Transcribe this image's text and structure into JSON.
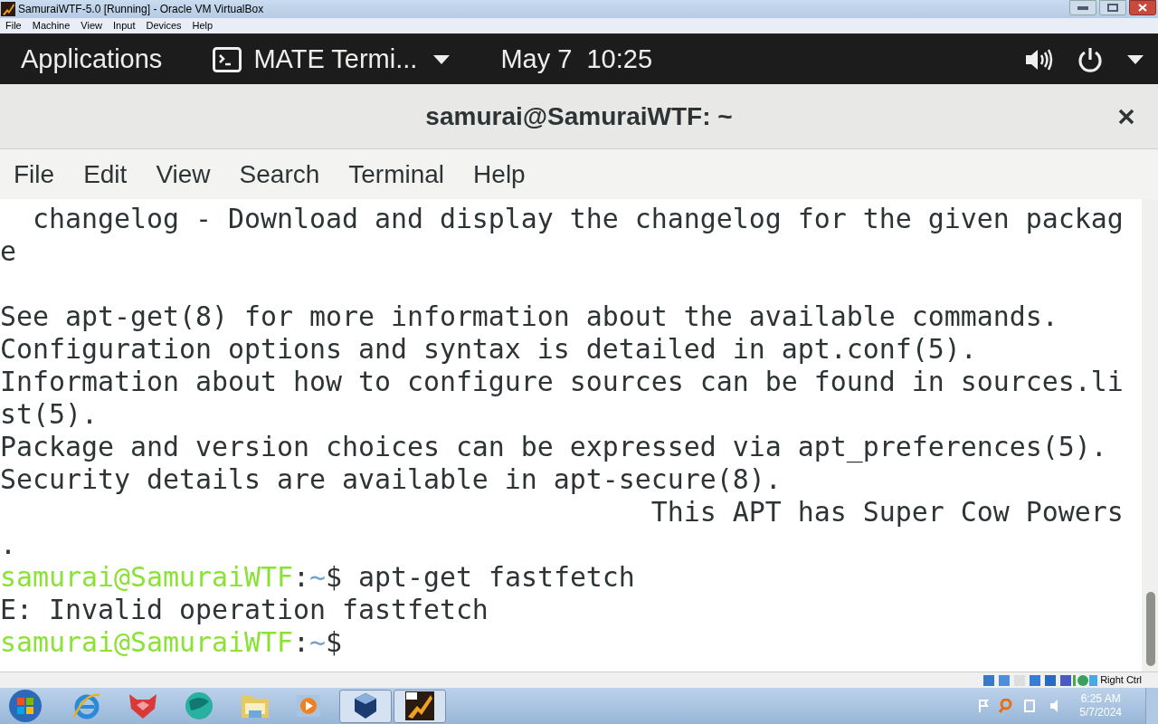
{
  "host_window": {
    "title": "SamuraiWTF-5.0 [Running] - Oracle VM VirtualBox",
    "menu": [
      "File",
      "Machine",
      "View",
      "Input",
      "Devices",
      "Help"
    ]
  },
  "top_panel": {
    "applications": "Applications",
    "task": "MATE Termi...",
    "clock": "May 7  10:25"
  },
  "terminal": {
    "title": "samurai@SamuraiWTF: ~",
    "menu": [
      "File",
      "Edit",
      "View",
      "Search",
      "Terminal",
      "Help"
    ],
    "lines": [
      {
        "kind": "text",
        "text": "  changelog - Download and display the changelog for the given packag"
      },
      {
        "kind": "text",
        "text": "e"
      },
      {
        "kind": "blank"
      },
      {
        "kind": "text",
        "text": "See apt-get(8) for more information about the available commands."
      },
      {
        "kind": "text",
        "text": "Configuration options and syntax is detailed in apt.conf(5)."
      },
      {
        "kind": "text",
        "text": "Information about how to configure sources can be found in sources.li"
      },
      {
        "kind": "text",
        "text": "st(5)."
      },
      {
        "kind": "text",
        "text": "Package and version choices can be expressed via apt_preferences(5)."
      },
      {
        "kind": "text",
        "text": "Security details are available in apt-secure(8)."
      },
      {
        "kind": "text",
        "text": "                                        This APT has Super Cow Powers"
      },
      {
        "kind": "text",
        "text": "."
      },
      {
        "kind": "prompt",
        "user": "samurai@SamuraiWTF",
        "sep": ":",
        "path": "~",
        "sign": "$",
        "command": " apt-get fastfetch"
      },
      {
        "kind": "text",
        "text": "E: Invalid operation fastfetch"
      },
      {
        "kind": "prompt",
        "user": "samurai@SamuraiWTF",
        "sep": ":",
        "path": "~",
        "sign": "$"
      }
    ]
  },
  "vbox_status": {
    "host_key": "Right Ctrl"
  },
  "taskbar": {
    "time": "6:25 AM",
    "date": "5/7/2024"
  }
}
